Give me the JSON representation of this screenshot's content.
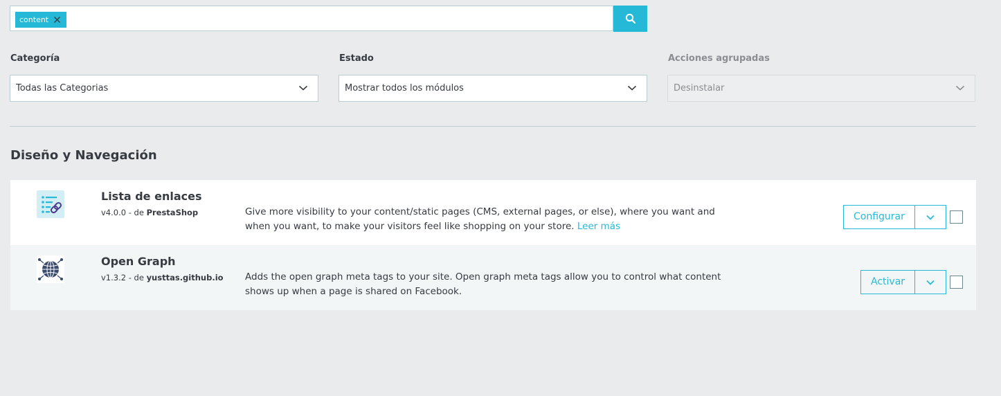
{
  "search": {
    "tag_label": "content",
    "icons": {
      "tag_remove": "close-icon",
      "submit": "search-icon"
    }
  },
  "filters": {
    "category": {
      "label": "Categoría",
      "value": "Todas las Categorias"
    },
    "status": {
      "label": "Estado",
      "value": "Mostrar todos los módulos"
    },
    "bulk": {
      "label": "Acciones agrupadas",
      "value": "Desinstalar"
    }
  },
  "section": {
    "title": "Diseño y Navegación"
  },
  "modules": [
    {
      "name": "Lista de enlaces",
      "version": "v4.0.0 - de ",
      "author": "PrestaShop",
      "description": "Give more visibility to your content/static pages (CMS, external pages, or else), where you want and when you want, to make your visitors feel like shopping on your store.",
      "read_more": "Leer más",
      "action": "Configurar",
      "icon": "link-list-icon"
    },
    {
      "name": "Open Graph",
      "version": "v1.3.2 - de ",
      "author": "yusttas.github.io",
      "description": "Adds the open graph meta tags to your site. Open graph meta tags allow you to control what content shows up when a page is shared on Facebook.",
      "action": "Activar",
      "icon": "globe-network-icon"
    }
  ],
  "colors": {
    "accent": "#25b9d7",
    "text": "#363a41",
    "background": "#eaebec"
  }
}
